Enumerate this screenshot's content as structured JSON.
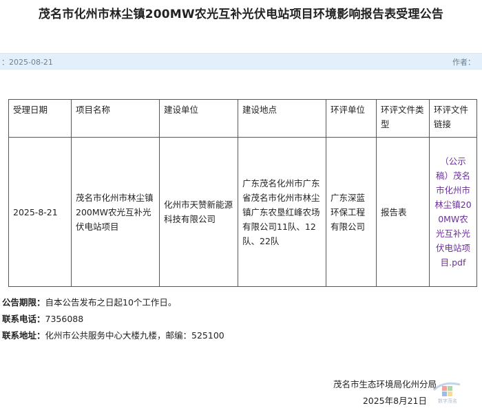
{
  "title": "茂名市化州市林尘镇200MW农光互补光伏电站项目环境影响报告表受理公告",
  "meta": {
    "date": "：2025-08-21",
    "author_label": "作者："
  },
  "table": {
    "headers": [
      "受理日期",
      "项目名称",
      "建设单位",
      "建设地点",
      "环评单位",
      "环评文件类型",
      "环评文件链接"
    ],
    "row": {
      "date": "2025-8-21",
      "project": "茂名市化州市林尘镇200MW农光互补光伏电站项目",
      "builder": "化州市天赞新能源科技有限公司",
      "location": "广东茂名化州市广东省茂名市化州市林尘镇广东农垦红峰农场有限公司11队、12队、22队",
      "eia_unit": "广东深蓝环保工程有限公司",
      "doc_type": "报告表",
      "link": "（公示稿）茂名市化州市林尘镇200MW农光互补光伏电站项目.pdf"
    }
  },
  "info": {
    "period_label": "公告期限：",
    "period_value": "自本公告发布之日起10个工作日。",
    "phone_label": "联系电话：",
    "phone_value": "7356088",
    "address_label": "联系地址：",
    "address_value": "化州市公共服务中心大楼九楼，邮编：525100"
  },
  "signature": {
    "org": "茂名市生态环境局化州分局",
    "date": "2025年8月21日"
  },
  "watermark": {
    "text": "数字茂名"
  },
  "colors": {
    "meta_bar": "#e3f0fb",
    "link": "#6a2f98"
  }
}
